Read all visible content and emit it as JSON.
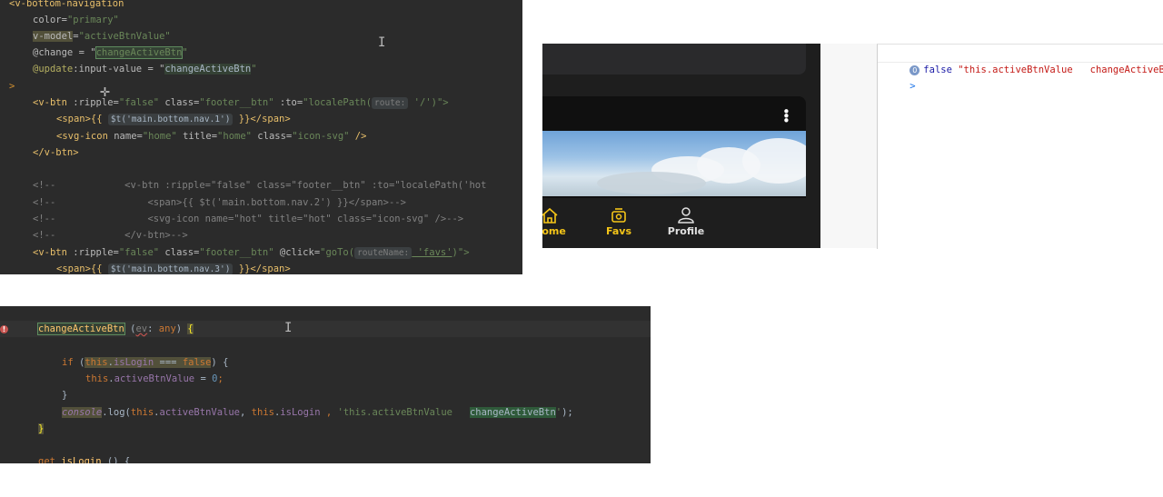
{
  "code_top": {
    "lines": [
      [
        "<v-bottom-navigation"
      ],
      [
        "color=",
        "\"primary\""
      ],
      [
        "v-model",
        "=",
        "\"activeBtnValue\""
      ],
      [
        "@change",
        " = \"",
        "changeActiveBtn",
        "\""
      ],
      [
        "@update",
        ":input-value",
        " = \"",
        "changeActiveBtn",
        "\""
      ],
      [
        ">"
      ],
      [
        "<v-btn",
        " :ripple=",
        "\"false\"",
        " class=",
        "\"footer__btn\"",
        " :to=",
        "\"localePath(",
        "route:",
        " '/'",
        ")\">"
      ],
      [
        "<span>{{ ",
        "$t('main.bottom.nav.1')",
        " }}</span>"
      ],
      [
        "<svg-icon",
        " name=",
        "\"home\"",
        " title=",
        "\"home\"",
        " class=",
        "\"icon-svg\"",
        " />"
      ],
      [
        "</v-btn>"
      ],
      [
        ""
      ],
      [
        "<!--",
        "            <v-btn :ripple=\"false\" class=\"footer__btn\" :to=\"localePath('hot"
      ],
      [
        "<!--",
        "                <span>{{ $t('main.bottom.nav.2') }}</span>-->"
      ],
      [
        "<!--",
        "                <svg-icon name=\"hot\" title=\"hot\" class=\"icon-svg\" />-->"
      ],
      [
        "<!--",
        "            </v-btn>-->"
      ],
      [
        "<v-btn",
        " :ripple=",
        "\"false\"",
        " class=",
        "\"footer__btn\"",
        " @click=",
        "\"goTo(",
        "routeName:",
        " 'favs'",
        ")\">"
      ],
      [
        "<span>{{ ",
        "$t('main.bottom.nav.3')",
        " }}</span>"
      ]
    ]
  },
  "code_bottom": {
    "lines": [
      [
        "changeActiveBtn",
        " (",
        "ev",
        ": ",
        "any",
        ") ",
        "{"
      ],
      [
        ""
      ],
      [
        "if",
        " (",
        "this",
        ".",
        "isLogin",
        " === ",
        "false",
        ") {"
      ],
      [
        "this",
        ".",
        "activeBtnValue",
        " = ",
        "0",
        ";"
      ],
      [
        "}"
      ],
      [
        "console",
        ".log(",
        "this",
        ".",
        "activeBtnValue",
        ", ",
        "this",
        ".",
        "isLogin",
        " , ",
        "'this.activeBtnValue   ",
        "changeActiveBtn",
        "'",
        ");"
      ],
      [
        "}"
      ],
      [
        ""
      ],
      [
        "get",
        " ",
        "isLogin",
        " () {"
      ]
    ]
  },
  "app": {
    "nav": [
      {
        "label": "Home",
        "icon": "home-icon"
      },
      {
        "label": "Favs",
        "icon": "favs-icon"
      },
      {
        "label": "Profile",
        "icon": "profile-icon"
      }
    ],
    "accent": "#f5c518",
    "menu_icon": "more-vertical-icon"
  },
  "console": {
    "count": "0",
    "value": "false",
    "message": "\"this.activeBtnValue   changeActiveBtn\"",
    "prompt": ">"
  },
  "colors": {
    "editor_bg": "#2b2b2b",
    "string_green": "#6a8759",
    "tag_yellow": "#e8bf6a",
    "keyword_orange": "#cc7832",
    "console_string_red": "#c41a16"
  }
}
